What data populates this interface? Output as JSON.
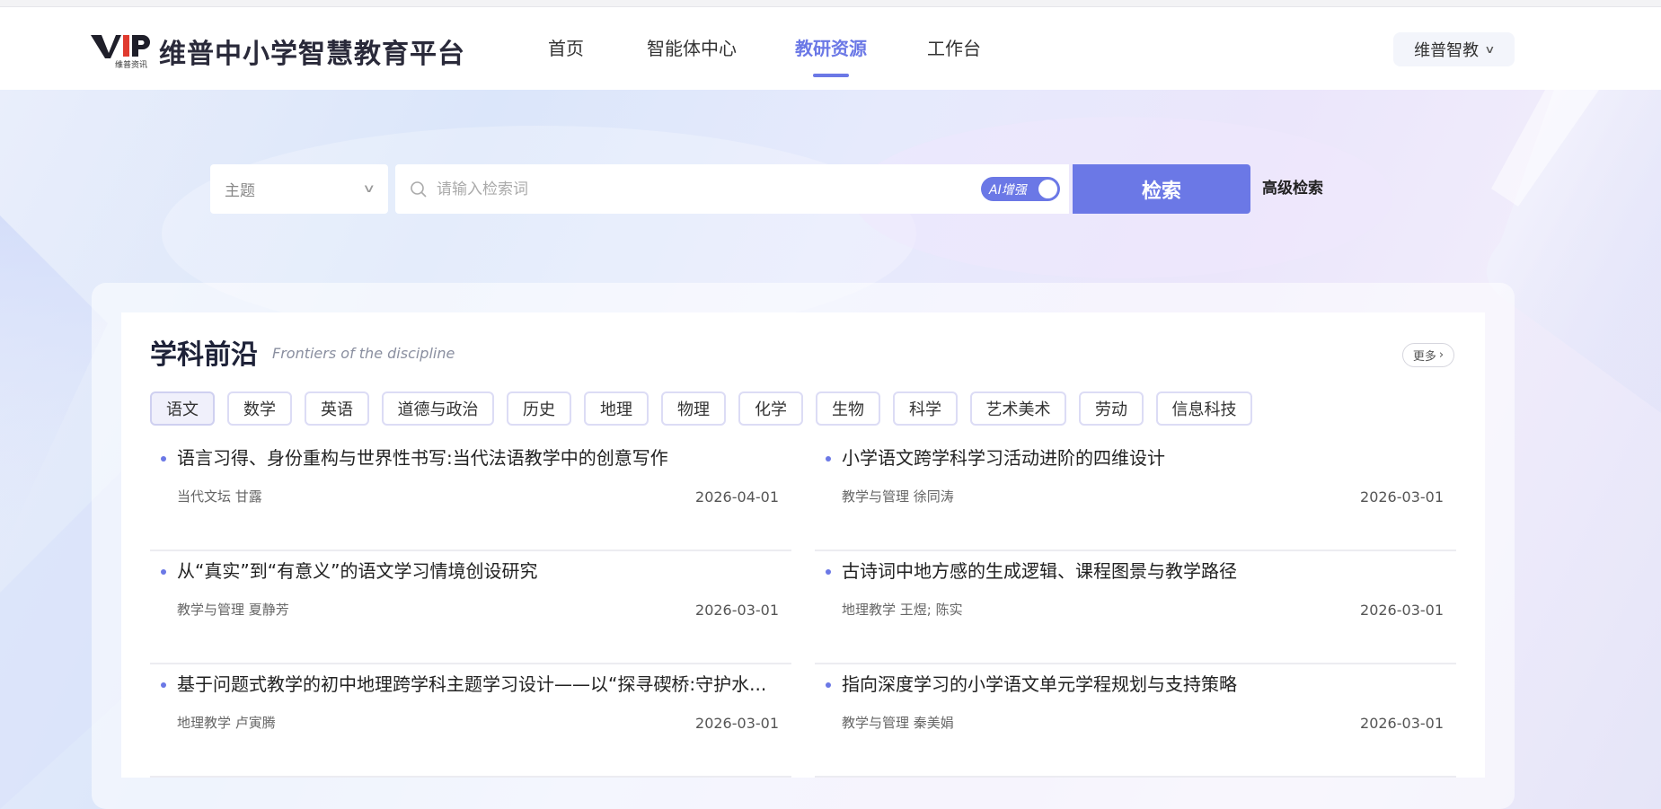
{
  "header": {
    "logo_mark_text": "VIP",
    "logo_sub": "维普资讯",
    "site_title": "维普中小学智慧教育平台",
    "nav": [
      {
        "label": "首页",
        "active": false
      },
      {
        "label": "智能体中心",
        "active": false
      },
      {
        "label": "教研资源",
        "active": true
      },
      {
        "label": "工作台",
        "active": false
      }
    ],
    "user_menu": "维普智教",
    "accent_color": "#6b78e6"
  },
  "search": {
    "field_select": "主题",
    "placeholder": "请输入检索词",
    "ai_toggle_label": "AI增强",
    "ai_enabled": true,
    "submit_label": "检索",
    "advanced_label": "高级检索"
  },
  "section": {
    "title": "学科前沿",
    "subtitle": "Frontiers of the discipline",
    "more_label": "更多",
    "tabs": [
      "语文",
      "数学",
      "英语",
      "道德与政治",
      "历史",
      "地理",
      "物理",
      "化学",
      "生物",
      "科学",
      "艺术美术",
      "劳动",
      "信息科技"
    ],
    "active_tab": "语文",
    "articles": [
      {
        "title": "语言习得、身份重构与世界性书写:当代法语教学中的创意写作",
        "meta": "当代文坛 甘露",
        "date": "2026-04-01"
      },
      {
        "title": "小学语文跨学科学习活动进阶的四维设计",
        "meta": "教学与管理 徐同涛",
        "date": "2026-03-01"
      },
      {
        "title": "从“真实”到“有意义”的语文学习情境创设研究",
        "meta": "教学与管理 夏静芳",
        "date": "2026-03-01"
      },
      {
        "title": "古诗词中地方感的生成逻辑、课程图景与教学路径",
        "meta": "地理教学 王煜; 陈实",
        "date": "2026-03-01"
      },
      {
        "title": "基于问题式教学的初中地理跨学科主题学习设计——以“探寻碶桥:守护水...",
        "meta": "地理教学 卢寅腾",
        "date": "2026-03-01"
      },
      {
        "title": "指向深度学习的小学语文单元学程规划与支持策略",
        "meta": "教学与管理 秦美娟",
        "date": "2026-03-01"
      }
    ]
  }
}
